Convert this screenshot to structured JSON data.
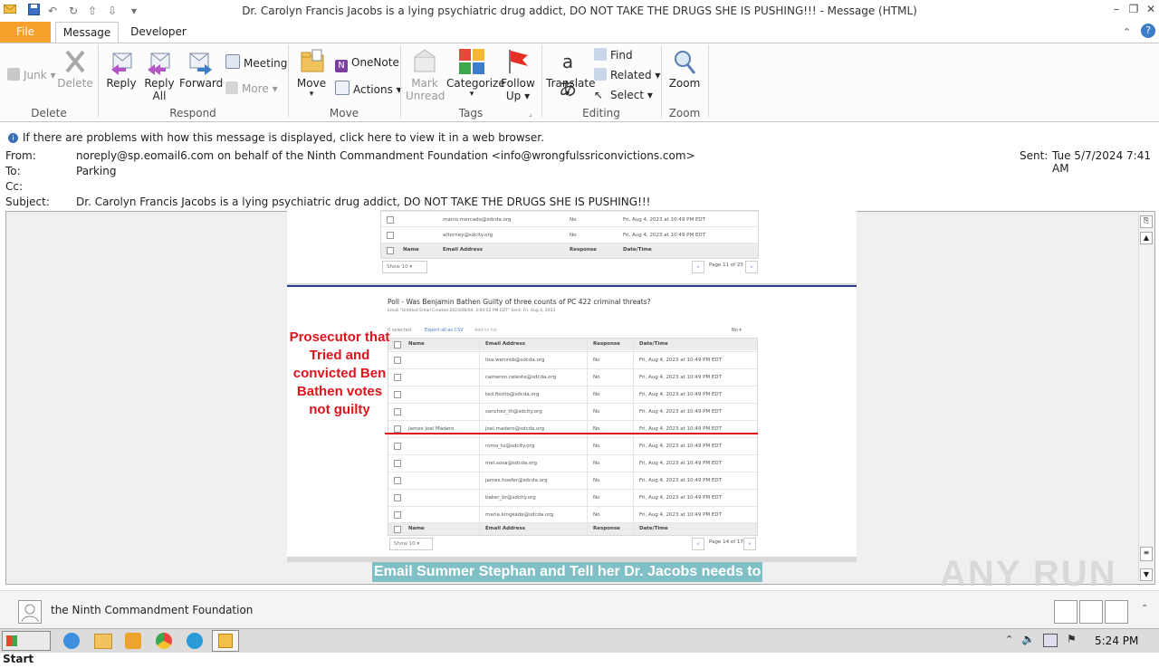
{
  "window": {
    "title": "Dr. Carolyn Francis Jacobs is a lying psychiatric drug addict, DO NOT TAKE THE DRUGS SHE IS PUSHING!!!  -  Message (HTML)"
  },
  "tabs": {
    "file": "File",
    "message": "Message",
    "developer": "Developer"
  },
  "ribbon": {
    "junk": "Junk",
    "delete": "Delete",
    "reply": "Reply",
    "reply_all_1": "Reply",
    "reply_all_2": "All",
    "forward": "Forward",
    "meeting": "Meeting",
    "more": "More",
    "move": "Move",
    "onenote": "OneNote",
    "actions": "Actions",
    "mark_unread_1": "Mark",
    "mark_unread_2": "Unread",
    "categorize": "Categorize",
    "follow_up_1": "Follow",
    "follow_up_2": "Up",
    "translate": "Translate",
    "find": "Find",
    "related": "Related",
    "select": "Select",
    "zoom": "Zoom",
    "groups": {
      "delete": "Delete",
      "respond": "Respond",
      "move": "Move",
      "tags": "Tags",
      "editing": "Editing",
      "zoom": "Zoom"
    }
  },
  "infobar": "If there are problems with how this message is displayed, click here to view it in a web browser.",
  "header": {
    "from_label": "From:",
    "from_value": "noreply@sp.eomail6.com on behalf of the Ninth Commandment Foundation <info@wrongfulssriconvictions.com>",
    "to_label": "To:",
    "to_value": "Parking",
    "cc_label": "Cc:",
    "subject_label": "Subject:",
    "subject_value": "Dr. Carolyn Francis Jacobs is a lying psychiatric drug addict, DO NOT TAKE THE DRUGS SHE IS PUSHING!!!",
    "sent_label": "Sent:",
    "sent_value": "Tue 5/7/2024 7:41 AM"
  },
  "body": {
    "top_table": {
      "rows": [
        {
          "email": "marco.mercado@sdcda.org",
          "response": "No",
          "date": "Fri, Aug 4, 2023 at 10:49 PM EDT"
        },
        {
          "email": "attorney@sdcity.org",
          "response": "No",
          "date": "Fri, Aug 4, 2023 at 10:49 PM EDT"
        }
      ],
      "headers": {
        "name": "Name",
        "email": "Email Address",
        "response": "Response",
        "date": "Date/Time"
      },
      "show": "Show 10",
      "page": "Page 11 of 23"
    },
    "poll": {
      "title": "Poll - Was Benjamin Bathen Guilty of three counts of PC 422 criminal threats?",
      "subtitle": "Email \"Untitled Email Created 2023/08/04, 3:04:52 PM EDT\"  Sent: Fri, Aug 4, 2023",
      "selected": "0 selected",
      "export": "Export all as CSV",
      "add": "Add to list",
      "filter": "No",
      "headers": {
        "name": "Name",
        "email": "Email Address",
        "response": "Response",
        "date": "Date/Time"
      },
      "rows": [
        {
          "name": "",
          "email": "lisa.weinreb@sdcda.org",
          "response": "No",
          "date": "Fri, Aug 4, 2023 at 10:49 PM EDT"
        },
        {
          "name": "",
          "email": "cameron.celeste@sdcda.org",
          "response": "No",
          "date": "Fri, Aug 4, 2023 at 10:49 PM EDT"
        },
        {
          "name": "",
          "email": "ted.fiorito@sdcda.org",
          "response": "No",
          "date": "Fri, Aug 4, 2023 at 10:49 PM EDT"
        },
        {
          "name": "",
          "email": "sanchez_th@sdcity.org",
          "response": "No",
          "date": "Fri, Aug 4, 2023 at 10:49 PM EDT"
        },
        {
          "name": "James Joel Madero",
          "email": "joel.madero@sdcda.org",
          "response": "No",
          "date": "Fri, Aug 4, 2023 at 10:49 PM EDT"
        },
        {
          "name": "",
          "email": "romo_to@sdcity.org",
          "response": "No",
          "date": "Fri, Aug 4, 2023 at 10:49 PM EDT"
        },
        {
          "name": "",
          "email": "mel.sosa@sdcda.org",
          "response": "No",
          "date": "Fri, Aug 4, 2023 at 10:49 PM EDT"
        },
        {
          "name": "",
          "email": "james.hoefer@sdcda.org",
          "response": "No",
          "date": "Fri, Aug 4, 2023 at 10:49 PM EDT"
        },
        {
          "name": "",
          "email": "baker_br@sdcity.org",
          "response": "No",
          "date": "Fri, Aug 4, 2023 at 10:49 PM EDT"
        },
        {
          "name": "",
          "email": "maria.kingkade@sdcda.org",
          "response": "No",
          "date": "Fri, Aug 4, 2023 at 10:49 PM EDT"
        }
      ],
      "show": "Show 10",
      "page": "Page 14 of 17"
    },
    "annotation": "Prosecutor that Tried and convicted Ben Bathen votes not guilty",
    "banner": "Email Summer Stephan and Tell her Dr. Jacobs needs to",
    "watermark": "ANY RUN"
  },
  "people_pane": {
    "name": "the Ninth Commandment Foundation"
  },
  "taskbar": {
    "start": "Start",
    "time": "5:24 PM"
  },
  "colors": {
    "file_tab": "#f6a12b",
    "annotation_red": "#e0121b",
    "banner_bg": "#7fbfc5",
    "divider_blue": "#2b3a8f"
  }
}
